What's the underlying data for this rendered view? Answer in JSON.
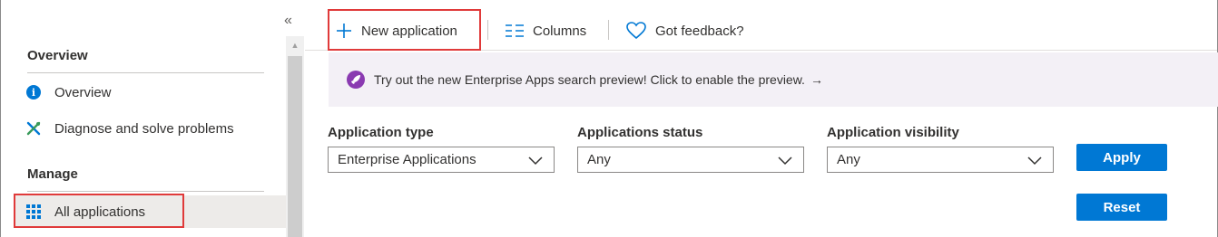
{
  "sidebar": {
    "collapse_glyph": "«",
    "sections": [
      {
        "header": "Overview"
      },
      {
        "header": "Manage"
      }
    ],
    "items": [
      {
        "label": "Overview",
        "icon": "info-icon"
      },
      {
        "label": "Diagnose and solve problems",
        "icon": "wrench-screwdriver-icon"
      },
      {
        "label": "All applications",
        "icon": "grid-icon",
        "selected": true
      }
    ]
  },
  "toolbar": {
    "new_application": "New application",
    "columns": "Columns",
    "feedback": "Got feedback?"
  },
  "banner": {
    "text": "Try out the new Enterprise Apps search preview! Click to enable the preview.",
    "arrow": "→"
  },
  "filters": {
    "application_type": {
      "label": "Application type",
      "value": "Enterprise Applications"
    },
    "applications_status": {
      "label": "Applications status",
      "value": "Any"
    },
    "application_visibility": {
      "label": "Application visibility",
      "value": "Any"
    }
  },
  "actions": {
    "apply": "Apply",
    "reset": "Reset"
  },
  "colors": {
    "accent": "#0078d4",
    "highlight": "#e03a3a",
    "banner_bg": "#f3f0f6",
    "rocket": "#8a3ab1"
  }
}
